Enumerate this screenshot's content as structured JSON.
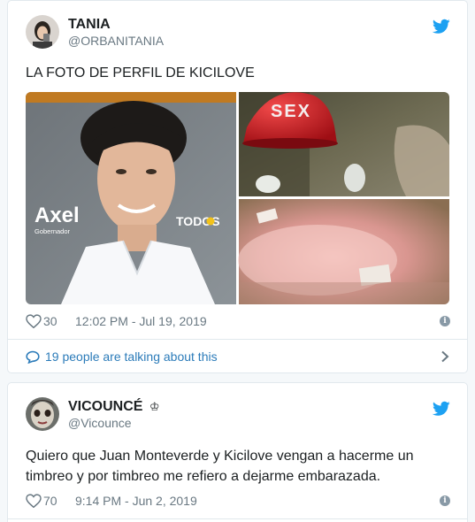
{
  "tweets": [
    {
      "name": "TANIA",
      "handle": "@ORBANITANIA",
      "text": "LA FOTO DE PERFIL DE KICILOVE",
      "media": {
        "poster_name": "Axel",
        "poster_role": "Gobernador",
        "poster_brand": "TODOS",
        "photo_sign": "SEX"
      },
      "likes": "30",
      "timestamp": "12:02 PM - Jul 19, 2019",
      "conversation": "19 people are talking about this"
    },
    {
      "name": "VICOUNCÉ",
      "name_badge": "♔",
      "handle": "@Vicounce",
      "text": "Quiero que Juan Monteverde y Kicilove vengan a hacerme un timbreo y por timbreo me refiero a dejarme embarazada.",
      "likes": "70",
      "timestamp": "9:14 PM - Jun 2, 2019"
    }
  ],
  "colors": {
    "twitter_blue": "#1da1f2",
    "link_blue": "#2b7bb9",
    "meta_gray": "#697882",
    "border": "#e1e8ed"
  },
  "icons": [
    "twitter-bird-icon",
    "heart-icon",
    "info-icon",
    "speech-bubble-icon",
    "chevron-right-icon"
  ]
}
